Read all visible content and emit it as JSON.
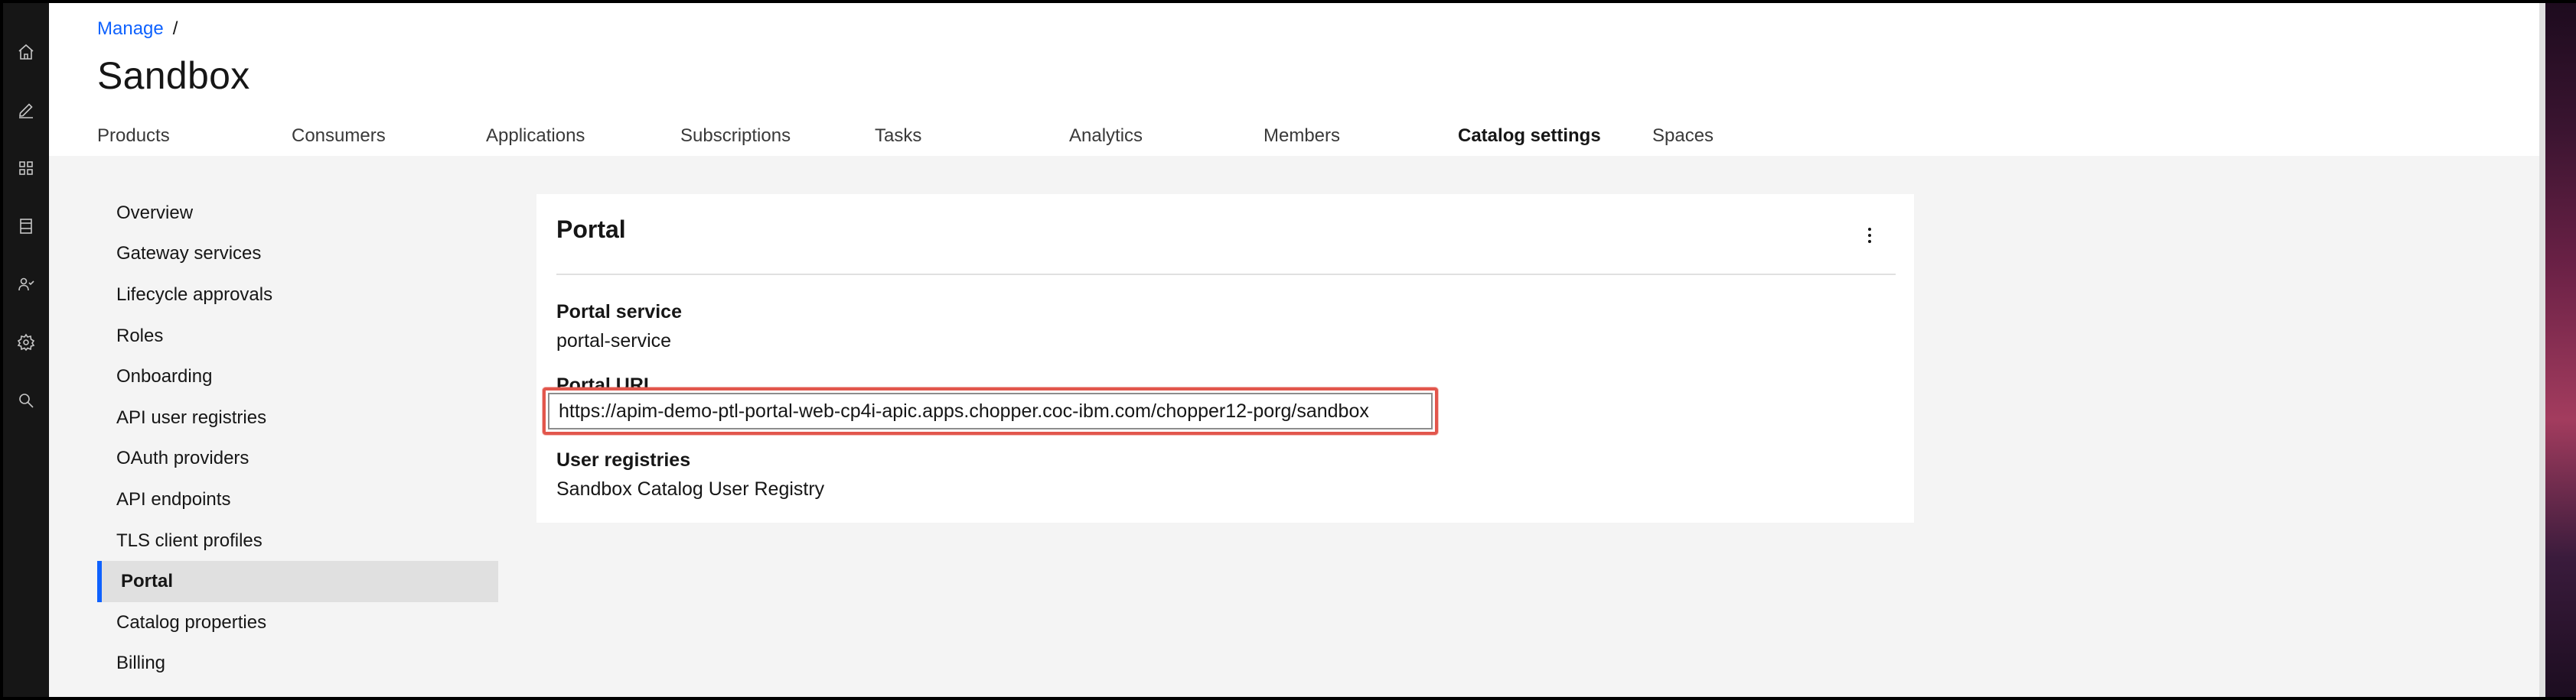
{
  "breadcrumb": {
    "root": "Manage",
    "separator": "/"
  },
  "page": {
    "title": "Sandbox"
  },
  "tabs": [
    {
      "label": "Products"
    },
    {
      "label": "Consumers"
    },
    {
      "label": "Applications"
    },
    {
      "label": "Subscriptions"
    },
    {
      "label": "Tasks"
    },
    {
      "label": "Analytics"
    },
    {
      "label": "Members"
    },
    {
      "label": "Catalog settings"
    },
    {
      "label": "Spaces"
    }
  ],
  "active_tab": "Catalog settings",
  "rail": {
    "icons": [
      "home-icon",
      "edit-icon",
      "apps-icon",
      "document-icon",
      "users-icon",
      "settings-icon",
      "search-icon"
    ]
  },
  "sidenav": {
    "items": [
      {
        "label": "Overview"
      },
      {
        "label": "Gateway services"
      },
      {
        "label": "Lifecycle approvals"
      },
      {
        "label": "Roles"
      },
      {
        "label": "Onboarding"
      },
      {
        "label": "API user registries"
      },
      {
        "label": "OAuth providers"
      },
      {
        "label": "API endpoints"
      },
      {
        "label": "TLS client profiles"
      },
      {
        "label": "Portal"
      },
      {
        "label": "Catalog properties"
      },
      {
        "label": "Billing"
      }
    ],
    "active": "Portal"
  },
  "card": {
    "title": "Portal",
    "overflow_icon": "overflow-menu-icon",
    "portal_service_label": "Portal service",
    "portal_service_value": "portal-service",
    "portal_url_label": "Portal URL",
    "portal_url_value": "https://apim-demo-ptl-portal-web-cp4i-apic.apps.chopper.coc-ibm.com/chopper12-porg/sandbox",
    "user_registries_label": "User registries",
    "user_registries_value": "Sandbox Catalog User Registry"
  },
  "colors": {
    "accent": "#0f62fe",
    "highlight_box": "#e2564c",
    "rail_bg": "#161616",
    "content_bg": "#f4f4f4"
  }
}
